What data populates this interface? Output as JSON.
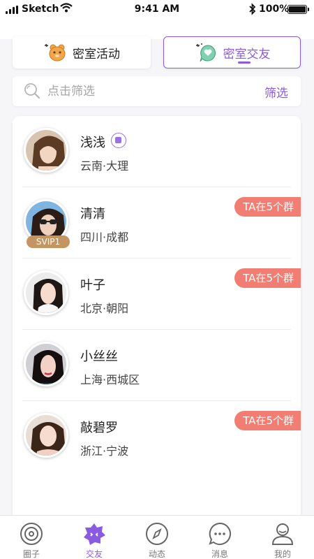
{
  "status_bar": {
    "carrier": "Sketch",
    "time": "9:41 AM",
    "battery": "100%"
  },
  "tabs": [
    {
      "label": "密室活动",
      "icon": "bear-icon",
      "active": false
    },
    {
      "label": "密室交友",
      "icon": "chat-heart-icon",
      "active": true
    }
  ],
  "search": {
    "placeholder": "点击筛选",
    "filter_label": "筛选"
  },
  "users": [
    {
      "name": "浅浅",
      "location": "云南·大理",
      "has_video": true,
      "badge": "",
      "vip": ""
    },
    {
      "name": "清清",
      "location": "四川·成都",
      "has_video": false,
      "badge": "TA在5个群",
      "vip": "SVIP1"
    },
    {
      "name": "叶子",
      "location": "北京·朝阳",
      "has_video": false,
      "badge": "TA在5个群",
      "vip": ""
    },
    {
      "name": "小丝丝",
      "location": "上海·西城区",
      "has_video": false,
      "badge": "",
      "vip": ""
    },
    {
      "name": "敲碧罗",
      "location": "浙江·宁波",
      "has_video": false,
      "badge": "TA在5个群",
      "vip": ""
    }
  ],
  "nav": [
    {
      "label": "圈子",
      "icon": "circle-icon"
    },
    {
      "label": "交友",
      "icon": "star-face-icon",
      "active": true
    },
    {
      "label": "动态",
      "icon": "compass-icon"
    },
    {
      "label": "消息",
      "icon": "message-icon"
    },
    {
      "label": "我的",
      "icon": "profile-icon"
    }
  ],
  "colors": {
    "accent": "#8a5be0",
    "badge": "#f27d72",
    "vip": "#c49560"
  }
}
